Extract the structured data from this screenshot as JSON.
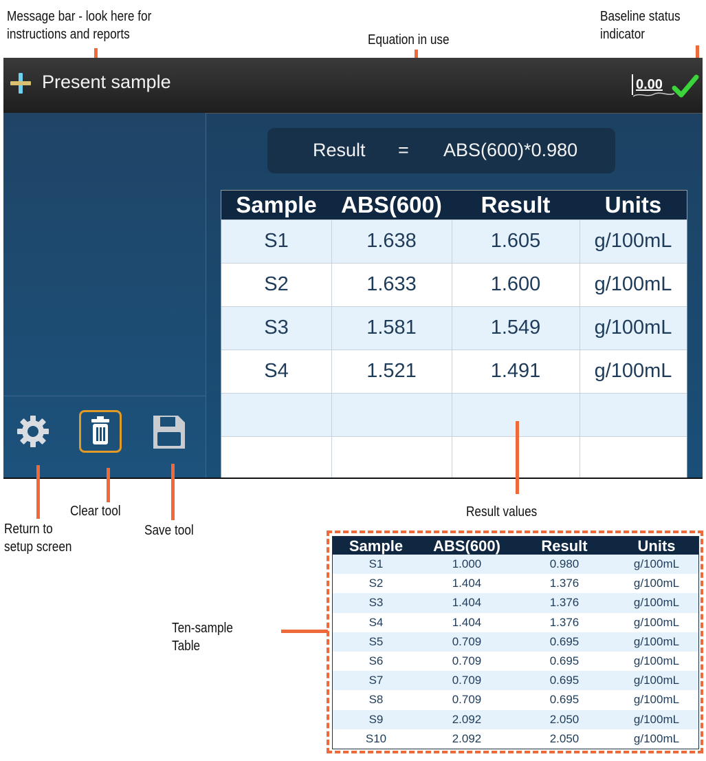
{
  "callouts": {
    "message_bar": [
      "Message bar - look here for",
      "instructions and reports"
    ],
    "equation": "Equation in use",
    "baseline": [
      "Baseline status",
      "indicator"
    ],
    "clear": "Clear tool",
    "return": [
      "Return to",
      "setup screen"
    ],
    "save": "Save tool",
    "results": "Result values",
    "ten_table": [
      "Ten-sample",
      "Table"
    ]
  },
  "screen": {
    "message": "Present sample",
    "baseline_value": "0.00",
    "equation": {
      "left": "Result",
      "op": "=",
      "right": "ABS(600)*0.980"
    },
    "table": {
      "headers": [
        "Sample",
        "ABS(600)",
        "Result",
        "Units"
      ],
      "rows": [
        [
          "S1",
          "1.638",
          "1.605",
          "g/100mL"
        ],
        [
          "S2",
          "1.633",
          "1.600",
          "g/100mL"
        ],
        [
          "S3",
          "1.581",
          "1.549",
          "g/100mL"
        ],
        [
          "S4",
          "1.521",
          "1.491",
          "g/100mL"
        ],
        [
          "",
          "",
          "",
          ""
        ],
        [
          "",
          "",
          "",
          ""
        ]
      ]
    },
    "tools": [
      "gear-icon",
      "trash-icon",
      "save-icon"
    ]
  },
  "ten_sample_table": {
    "headers": [
      "Sample",
      "ABS(600)",
      "Result",
      "Units"
    ],
    "rows": [
      [
        "S1",
        "1.000",
        "0.980",
        "g/100mL"
      ],
      [
        "S2",
        "1.404",
        "1.376",
        "g/100mL"
      ],
      [
        "S3",
        "1.404",
        "1.376",
        "g/100mL"
      ],
      [
        "S4",
        "1.404",
        "1.376",
        "g/100mL"
      ],
      [
        "S5",
        "0.709",
        "0.695",
        "g/100mL"
      ],
      [
        "S6",
        "0.709",
        "0.695",
        "g/100mL"
      ],
      [
        "S7",
        "0.709",
        "0.695",
        "g/100mL"
      ],
      [
        "S8",
        "0.709",
        "0.695",
        "g/100mL"
      ],
      [
        "S9",
        "2.092",
        "2.050",
        "g/100mL"
      ],
      [
        "S10",
        "2.092",
        "2.050",
        "g/100mL"
      ]
    ]
  },
  "colors": {
    "callout": "#ee6a3a",
    "screen_bg": "#1a4f78",
    "header": "#0f2740",
    "row_alt": "#e6f2fb",
    "baseline_check": "#3bd43b",
    "trash_border": "#e39b28"
  }
}
